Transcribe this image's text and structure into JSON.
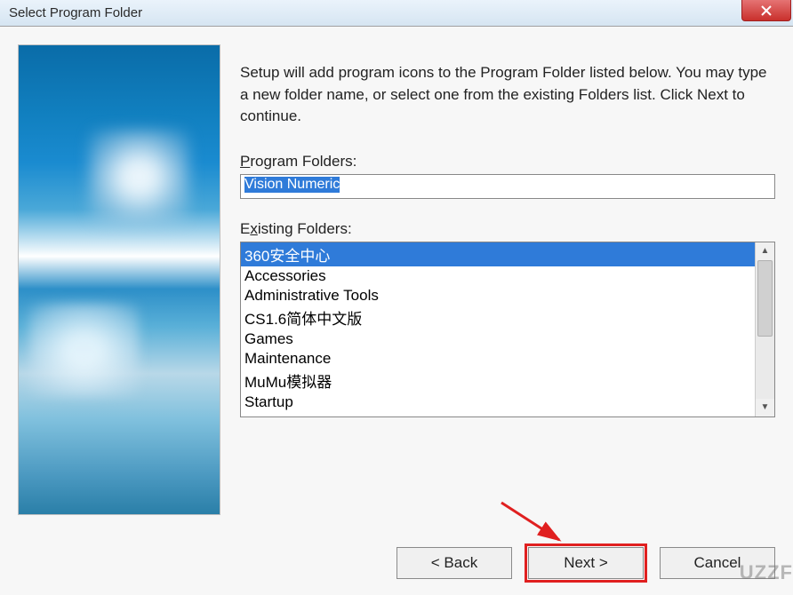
{
  "titlebar": {
    "title": "Select Program Folder"
  },
  "main": {
    "description": "Setup will add program icons to the Program Folder listed below. You may type a new folder name, or select one from the existing Folders list.  Click Next to continue.",
    "program_folders_label_u": "P",
    "program_folders_label": "rogram Folders:",
    "program_folder_value": "Vision Numeric",
    "existing_label_pre": "E",
    "existing_label_u": "x",
    "existing_label_post": "isting Folders:",
    "folders": [
      "360安全中心",
      "Accessories",
      "Administrative Tools",
      "CS1.6简体中文版",
      "Games",
      "Maintenance",
      "MuMu模拟器",
      "Startup"
    ],
    "selected_folder_index": 0
  },
  "buttons": {
    "back": "< Back",
    "next": "Next >",
    "cancel": "Cancel"
  },
  "watermark": "UZZF"
}
